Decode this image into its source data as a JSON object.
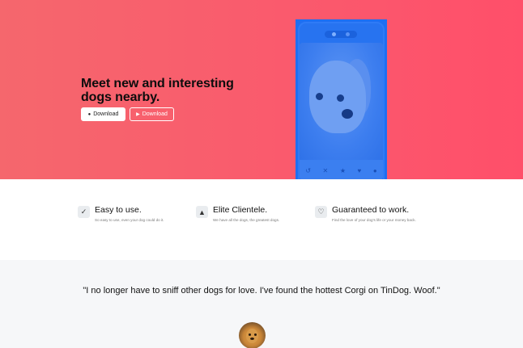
{
  "hero": {
    "title": "Meet new and interesting dogs nearby.",
    "download_apple_label": "Download",
    "download_play_label": "Download",
    "apple_icon": "apple-icon",
    "play_icon": "play-icon",
    "background_color": "#fa5a6d"
  },
  "phone": {
    "accent_color": "#1e6ff2",
    "action_icons": [
      "undo-icon",
      "close-icon",
      "star-icon",
      "heart-icon",
      "bolt-icon"
    ]
  },
  "features": [
    {
      "icon": "check-circle-icon",
      "title": "Easy to use.",
      "description": "So easy to use, even your dog could do it."
    },
    {
      "icon": "graduation-cap-icon",
      "title": "Elite Clientele.",
      "description": "We have all the dogs, the greatest dogs."
    },
    {
      "icon": "heart-icon",
      "title": "Guaranteed to work.",
      "description": "Find the love of your dog's life or your money back."
    }
  ],
  "testimonial": {
    "quote": "\"I no longer have to sniff other dogs for love. I've found the hottest Corgi on TinDog. Woof.\"",
    "avatar": "dog-avatar"
  }
}
